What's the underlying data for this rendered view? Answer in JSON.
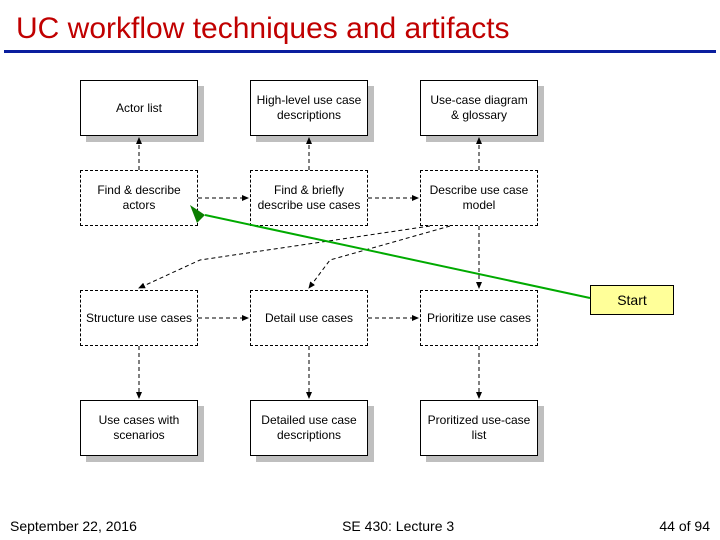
{
  "title": "UC workflow techniques and artifacts",
  "boxes": {
    "actor_list": "Actor list",
    "hl_desc": "High-level use case descriptions",
    "uc_diag_gloss": "Use-case diagram & glossary",
    "find_actors": "Find & describe actors",
    "find_brief": "Find & briefly describe use cases",
    "describe_model": "Describe use case model",
    "structure": "Structure use cases",
    "detail": "Detail use cases",
    "prioritize": "Prioritize use cases",
    "scenarios": "Use cases with scenarios",
    "detailed_desc": "Detailed use case descriptions",
    "prioritized_list": "Proritized use-case list"
  },
  "start_label": "Start",
  "footer": {
    "date": "September 22, 2016",
    "center": "SE 430: Lecture 3",
    "page": "44 of 94"
  },
  "chart_data": {
    "type": "diagram",
    "title": "UC workflow techniques and artifacts",
    "nodes": [
      {
        "id": "actor_list",
        "label": "Actor list",
        "kind": "artifact"
      },
      {
        "id": "hl_desc",
        "label": "High-level use case descriptions",
        "kind": "artifact"
      },
      {
        "id": "uc_diag_gloss",
        "label": "Use-case diagram & glossary",
        "kind": "artifact"
      },
      {
        "id": "find_actors",
        "label": "Find & describe actors",
        "kind": "activity"
      },
      {
        "id": "find_brief",
        "label": "Find & briefly describe use cases",
        "kind": "activity"
      },
      {
        "id": "describe_model",
        "label": "Describe use case model",
        "kind": "activity"
      },
      {
        "id": "structure",
        "label": "Structure use cases",
        "kind": "activity"
      },
      {
        "id": "detail",
        "label": "Detail use cases",
        "kind": "activity"
      },
      {
        "id": "prioritize",
        "label": "Prioritize use cases",
        "kind": "activity"
      },
      {
        "id": "scenarios",
        "label": "Use cases with scenarios",
        "kind": "artifact"
      },
      {
        "id": "detailed_desc",
        "label": "Detailed use case descriptions",
        "kind": "artifact"
      },
      {
        "id": "prioritized_list",
        "label": "Proritized use-case list",
        "kind": "artifact"
      },
      {
        "id": "start",
        "label": "Start",
        "kind": "callout"
      }
    ],
    "edges": [
      {
        "from": "find_actors",
        "to": "actor_list"
      },
      {
        "from": "find_actors",
        "to": "find_brief"
      },
      {
        "from": "find_brief",
        "to": "hl_desc"
      },
      {
        "from": "find_brief",
        "to": "describe_model"
      },
      {
        "from": "describe_model",
        "to": "uc_diag_gloss"
      },
      {
        "from": "describe_model",
        "to": "prioritize"
      },
      {
        "from": "describe_model",
        "to": "detail"
      },
      {
        "from": "describe_model",
        "to": "structure"
      },
      {
        "from": "structure",
        "to": "detail"
      },
      {
        "from": "detail",
        "to": "prioritize"
      },
      {
        "from": "structure",
        "to": "scenarios"
      },
      {
        "from": "detail",
        "to": "detailed_desc"
      },
      {
        "from": "prioritize",
        "to": "prioritized_list"
      },
      {
        "from": "start",
        "to": "find_actors"
      }
    ]
  }
}
